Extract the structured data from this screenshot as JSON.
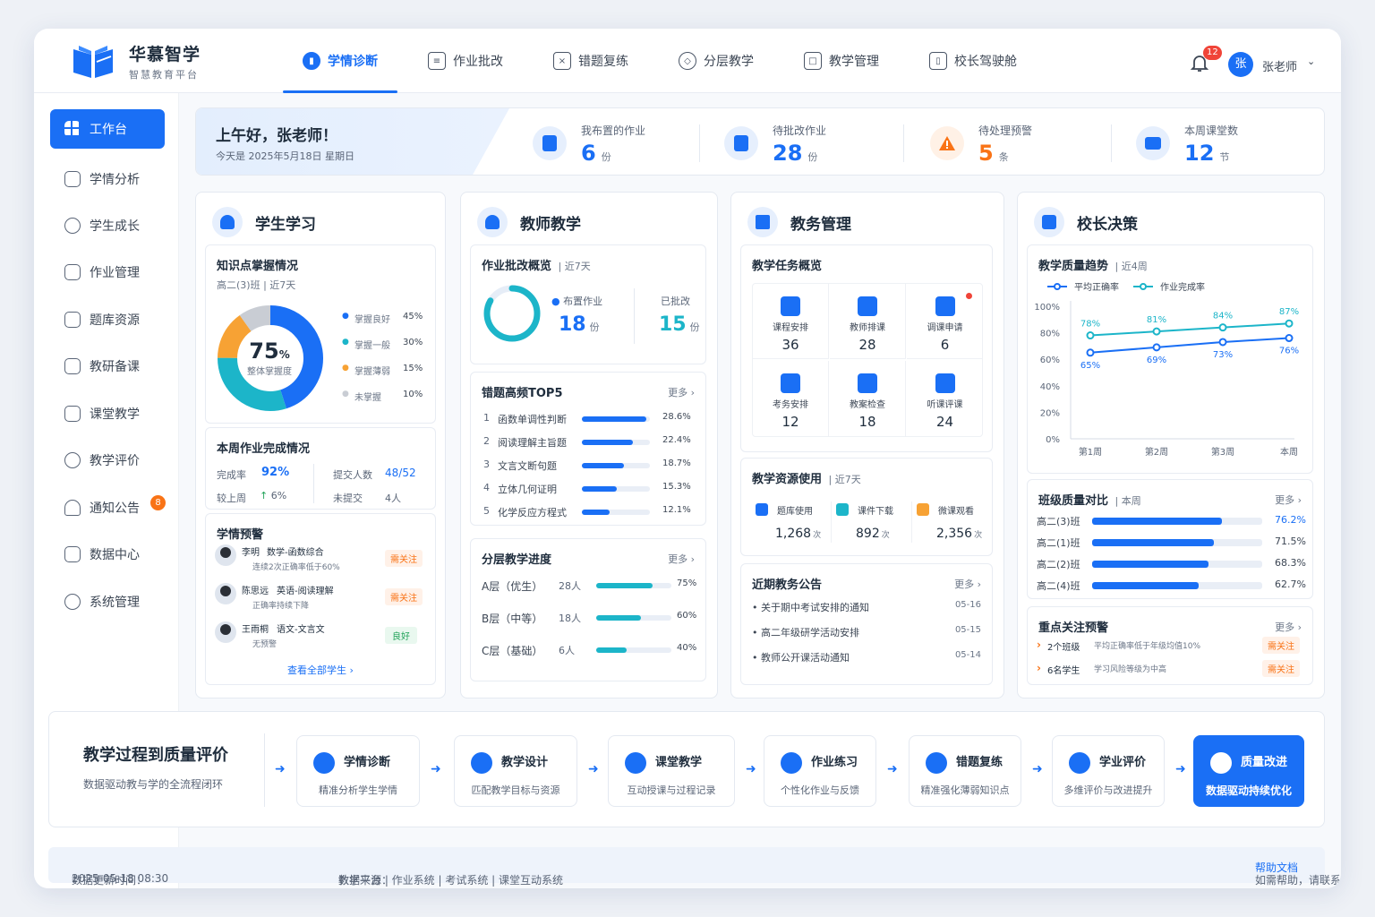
{
  "app": {
    "title": "华慕智学",
    "subtitle": "智慧教育平台"
  },
  "nav": [
    {
      "label": "学情诊断",
      "icon": "chart-icon",
      "active": true
    },
    {
      "label": "作业批改",
      "icon": "document-icon"
    },
    {
      "label": "错题复练",
      "icon": "error-icon"
    },
    {
      "label": "分层教学",
      "icon": "layers-icon"
    },
    {
      "label": "教学管理",
      "icon": "clipboard-icon"
    },
    {
      "label": "校长驾驶舱",
      "icon": "dashboard-icon"
    }
  ],
  "header": {
    "notification_count": "12",
    "avatar_text": "张",
    "user_name": "张老师"
  },
  "sidebar": [
    {
      "label": "工作台",
      "active": true
    },
    {
      "label": "学情分析"
    },
    {
      "label": "学生成长"
    },
    {
      "label": "作业管理"
    },
    {
      "label": "题库资源"
    },
    {
      "label": "教研备课"
    },
    {
      "label": "课堂教学"
    },
    {
      "label": "教学评价"
    },
    {
      "label": "通知公告",
      "badge": "8"
    },
    {
      "label": "数据中心"
    },
    {
      "label": "系统管理"
    }
  ],
  "greeting": {
    "title": "上午好，张老师！",
    "date": "今天是 2025年5月18日 星期日"
  },
  "kpis": [
    {
      "label": "我布置的作业",
      "value": "6",
      "unit": "份",
      "color": "#1a6ff5"
    },
    {
      "label": "待批改作业",
      "value": "28",
      "unit": "份",
      "color": "#1a6ff5"
    },
    {
      "label": "待处理预警",
      "value": "5",
      "unit": "条",
      "color": "#f97316"
    },
    {
      "label": "本周课堂数",
      "value": "12",
      "unit": "节",
      "color": "#1a6ff5"
    }
  ],
  "student": {
    "title": "学生学习",
    "mastery": {
      "title": "知识点掌握情况",
      "class": "高二(3)班",
      "period": "近7天",
      "center_value": "75",
      "center_unit": "%",
      "center_label": "整体掌握度",
      "legend": [
        {
          "label": "掌握良好",
          "value": "45%",
          "pct": 45,
          "color": "#1a6ff5"
        },
        {
          "label": "掌握一般",
          "value": "30%",
          "pct": 30,
          "color": "#1cb5c9"
        },
        {
          "label": "掌握薄弱",
          "value": "15%",
          "pct": 15,
          "color": "#f7a234"
        },
        {
          "label": "未掌握",
          "value": "10%",
          "pct": 10,
          "color": "#c9cdd4"
        }
      ]
    },
    "weekly": {
      "title": "本周作业完成情况",
      "rate_label": "完成率",
      "rate_value": "92%",
      "submit_label": "提交人数",
      "submit_value": "48/52",
      "last_label": "较上周",
      "last_value": "6%",
      "unsubmit_label": "未提交",
      "unsubmit_value": "4人"
    },
    "alerts": {
      "title": "学情预警",
      "items": [
        {
          "name": "李明",
          "subject": "数学-函数综合",
          "desc": "连续2次正确率低于60%",
          "tag": "需关注",
          "level": "warn"
        },
        {
          "name": "陈思远",
          "subject": "英语-阅读理解",
          "desc": "正确率持续下降",
          "tag": "需关注",
          "level": "warn"
        },
        {
          "name": "王雨桐",
          "subject": "语文-文言文",
          "desc": "无预警",
          "tag": "良好",
          "level": "good"
        }
      ],
      "view_all": "查看全部学生"
    }
  },
  "teacher": {
    "title": "教师教学",
    "overview": {
      "title": "作业批改概览",
      "period": "近7天",
      "assigned_label": "布置作业",
      "assigned_value": "18",
      "assigned_unit": "份",
      "graded_label": "已批改",
      "graded_value": "15",
      "graded_unit": "份"
    },
    "top5": {
      "title": "错题高频TOP5",
      "more": "更多",
      "items": [
        {
          "rank": "1",
          "label": "函数单调性判断",
          "value": "28.6%",
          "pct": 28.6
        },
        {
          "rank": "2",
          "label": "阅读理解主旨题",
          "value": "22.4%",
          "pct": 22.4
        },
        {
          "rank": "3",
          "label": "文言文断句题",
          "value": "18.7%",
          "pct": 18.7
        },
        {
          "rank": "4",
          "label": "立体几何证明",
          "value": "15.3%",
          "pct": 15.3
        },
        {
          "rank": "5",
          "label": "化学反应方程式",
          "value": "12.1%",
          "pct": 12.1
        }
      ]
    },
    "layered": {
      "title": "分层教学进度",
      "more": "更多",
      "items": [
        {
          "label": "A层（优生）",
          "count": "28人",
          "value": "75%",
          "pct": 75
        },
        {
          "label": "B层（中等）",
          "count": "18人",
          "value": "60%",
          "pct": 60
        },
        {
          "label": "C层（基础）",
          "count": "6人",
          "value": "40%",
          "pct": 40
        }
      ]
    }
  },
  "affairs": {
    "title": "教务管理",
    "tasks": {
      "title": "教学任务概览",
      "items": [
        {
          "label": "课程安排",
          "value": "36"
        },
        {
          "label": "教师排课",
          "value": "28"
        },
        {
          "label": "调课申请",
          "value": "6",
          "dot": true
        },
        {
          "label": "考务安排",
          "value": "12"
        },
        {
          "label": "教案检查",
          "value": "18"
        },
        {
          "label": "听课评课",
          "value": "24"
        }
      ]
    },
    "resources": {
      "title": "教学资源使用",
      "period": "近7天",
      "items": [
        {
          "label": "题库使用",
          "value": "1,268",
          "unit": "次",
          "color": "#1a6ff5"
        },
        {
          "label": "课件下载",
          "value": "892",
          "unit": "次",
          "color": "#1cb5c9"
        },
        {
          "label": "微课观看",
          "value": "2,356",
          "unit": "次",
          "color": "#f7a234"
        }
      ]
    },
    "notices": {
      "title": "近期教务公告",
      "more": "更多",
      "items": [
        {
          "label": "关于期中考试安排的通知",
          "date": "05-16"
        },
        {
          "label": "高二年级研学活动安排",
          "date": "05-15"
        },
        {
          "label": "教师公开课活动通知",
          "date": "05-14"
        }
      ]
    }
  },
  "principal": {
    "title": "校长决策",
    "quality_title": "教学质量趋势",
    "quality_period": "近4周",
    "compare": {
      "title": "班级质量对比",
      "period": "本周",
      "more": "更多",
      "items": [
        {
          "label": "高二(3)班",
          "value": "76.2%",
          "pct": 76.2,
          "highlight": true
        },
        {
          "label": "高二(1)班",
          "value": "71.5%",
          "pct": 71.5
        },
        {
          "label": "高二(2)班",
          "value": "68.3%",
          "pct": 68.3
        },
        {
          "label": "高二(4)班",
          "value": "62.7%",
          "pct": 62.7
        }
      ]
    },
    "focus": {
      "title": "重点关注预警",
      "more": "更多",
      "items": [
        {
          "label": "2个班级",
          "desc": "平均正确率低于年级均值10%",
          "tag": "需关注"
        },
        {
          "label": "6名学生",
          "desc": "学习风险等级为中高",
          "tag": "需关注"
        }
      ]
    }
  },
  "chart_data": {
    "type": "line",
    "x": [
      "第1周",
      "第2周",
      "第3周",
      "本周"
    ],
    "series": [
      {
        "name": "平均正确率",
        "values": [
          65,
          69,
          73,
          76
        ],
        "color": "#1a6ff5"
      },
      {
        "name": "作业完成率",
        "values": [
          78,
          81,
          84,
          87
        ],
        "color": "#1cb5c9"
      }
    ],
    "ylim": [
      0,
      100
    ],
    "yticks": [
      "0%",
      "20%",
      "40%",
      "60%",
      "80%",
      "100%"
    ],
    "legend": "top-left",
    "grid": false
  },
  "flow": {
    "title": "教学过程到质量评价",
    "subtitle": "数据驱动教与学的全流程闭环",
    "steps": [
      {
        "title": "学情诊断",
        "desc": "精准分析学生学情"
      },
      {
        "title": "教学设计",
        "desc": "匹配教学目标与资源"
      },
      {
        "title": "课堂教学",
        "desc": "互动授课与过程记录"
      },
      {
        "title": "作业练习",
        "desc": "个性化作业与反馈"
      },
      {
        "title": "错题复练",
        "desc": "精准强化薄弱知识点"
      },
      {
        "title": "学业评价",
        "desc": "多维评价与改进提升"
      },
      {
        "title": "质量改进",
        "desc": "数据驱动持续优化"
      }
    ]
  },
  "footer": {
    "update_label": "数据更新时间：",
    "update_time": "2025-05-18 08:30",
    "source_label": "数据来源：",
    "sources": "教学平台 | 作业系统 | 考试系统 | 课堂互动系统",
    "help_text": "如需帮助，请联系信息中心或查看",
    "help_link": "帮助文档"
  }
}
